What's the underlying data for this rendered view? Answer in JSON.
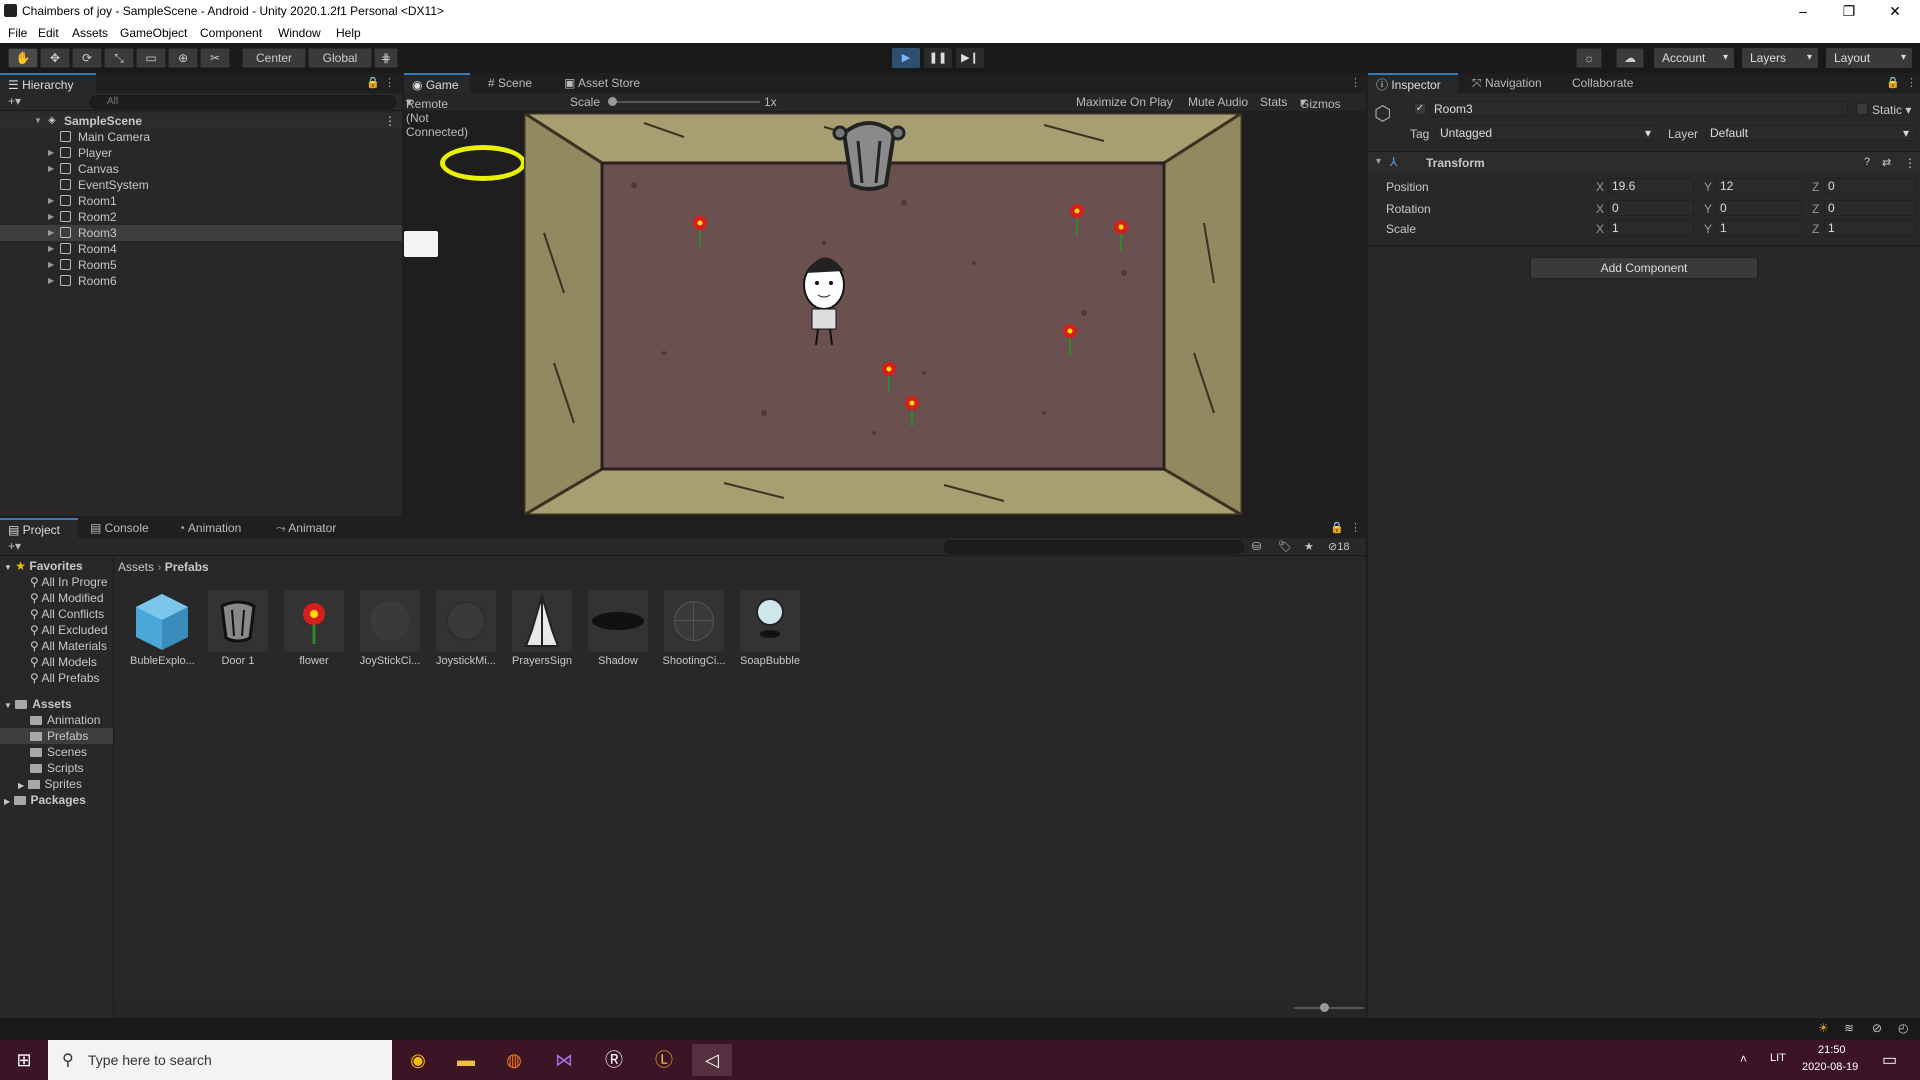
{
  "window": {
    "title": "Chaimbers of joy - SampleScene - Android - Unity 2020.1.2f1 Personal <DX11>"
  },
  "menu": [
    "File",
    "Edit",
    "Assets",
    "GameObject",
    "Component",
    "Window",
    "Help"
  ],
  "toolbar": {
    "pivot": "Center",
    "space": "Global",
    "account": "Account",
    "layers": "Layers",
    "layout": "Layout"
  },
  "hierarchy": {
    "tab": "Hierarchy",
    "search_placeholder": "All",
    "scene": "SampleScene",
    "items": [
      "Main Camera",
      "Player",
      "Canvas",
      "EventSystem",
      "Room1",
      "Room2",
      "Room3",
      "Room4",
      "Room5",
      "Room6"
    ],
    "selected": "Room3"
  },
  "center_tabs": [
    "Game",
    "Scene",
    "Asset Store"
  ],
  "gamebar": {
    "display": "Remote (Not Connected)",
    "scale_label": "Scale",
    "scale_value": "1x",
    "maximize": "Maximize On Play",
    "mute": "Mute Audio",
    "stats": "Stats",
    "gizmos": "Gizmos"
  },
  "inspector": {
    "tabs": [
      "Inspector",
      "Navigation",
      "Collaborate"
    ],
    "object_name": "Room3",
    "static_label": "Static",
    "tag_label": "Tag",
    "tag_value": "Untagged",
    "layer_label": "Layer",
    "layer_value": "Default",
    "component": "Transform",
    "position": {
      "label": "Position",
      "x": "19.6",
      "y": "12",
      "z": "0"
    },
    "rotation": {
      "label": "Rotation",
      "x": "0",
      "y": "0",
      "z": "0"
    },
    "scale": {
      "label": "Scale",
      "x": "1",
      "y": "1",
      "z": "1"
    },
    "add_component": "Add Component"
  },
  "bottom_tabs": [
    "Project",
    "Console",
    "Animation",
    "Animator"
  ],
  "project": {
    "favorites_label": "Favorites",
    "favorites": [
      "All In Progre",
      "All Modified",
      "All Conflicts",
      "All Excluded",
      "All Materials",
      "All Models",
      "All Prefabs"
    ],
    "assets_label": "Assets",
    "asset_folders": [
      "Animation",
      "Prefabs",
      "Scenes",
      "Scripts",
      "Sprites"
    ],
    "packages_label": "Packages",
    "breadcrumb": [
      "Assets",
      "Prefabs"
    ],
    "hidden_count": "18",
    "items": [
      "BubleExplo...",
      "Door 1",
      "flower",
      "JoyStickCi...",
      "JoystickMi...",
      "PrayersSign",
      "Shadow",
      "ShootingCi...",
      "SoapBubble"
    ]
  },
  "taskbar": {
    "search_placeholder": "Type here to search",
    "lang": "LIT",
    "time": "21:50",
    "date": "2020-08-19"
  },
  "colors": {
    "accent": "#3a79bb",
    "room_floor": "#6b5050",
    "room_wall": "#9c9468",
    "taskbar": "#3b1426"
  }
}
